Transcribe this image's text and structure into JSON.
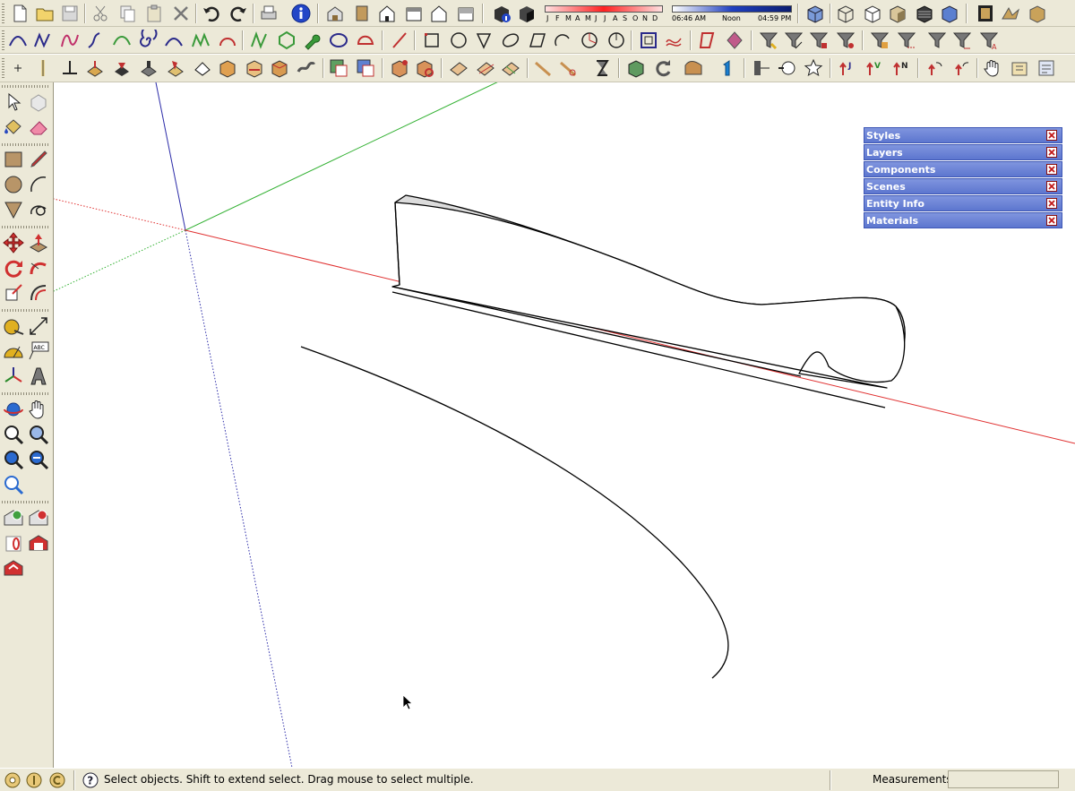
{
  "shadow_settings": {
    "months": [
      "J",
      "F",
      "M",
      "A",
      "M",
      "J",
      "J",
      "A",
      "S",
      "O",
      "N",
      "D"
    ],
    "sunrise_time": "06:46 AM",
    "noon_label": "Noon",
    "sunset_time": "04:59 PM"
  },
  "tray": {
    "panels": [
      {
        "label": "Styles"
      },
      {
        "label": "Layers"
      },
      {
        "label": "Components"
      },
      {
        "label": "Scenes"
      },
      {
        "label": "Entity Info"
      },
      {
        "label": "Materials"
      }
    ]
  },
  "statusbar": {
    "hint": "Select objects. Shift to extend select. Drag mouse to select multiple.",
    "measurements_label": "Measurements",
    "measurements_value": ""
  },
  "colors": {
    "toolbar_bg": "#ece9d8",
    "tray_blue": "#6a82d4",
    "axis_red": "#e03030",
    "axis_green": "#30b030",
    "axis_blue": "#2a2aa8"
  }
}
